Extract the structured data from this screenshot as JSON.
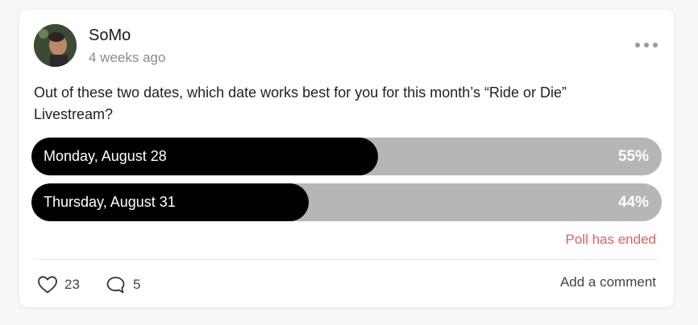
{
  "post": {
    "author": "SoMo",
    "time": "4 weeks ago",
    "question": "Out of these two dates, which date works best for you for this month’s “Ride or Die” Livestream?"
  },
  "poll": {
    "options": [
      {
        "label": "Monday, August 28",
        "percent_text": "55%",
        "fill_fraction": 0.55
      },
      {
        "label": "Thursday, August 31",
        "percent_text": "44%",
        "fill_fraction": 0.44
      }
    ],
    "status": "Poll has ended"
  },
  "footer": {
    "likes": "23",
    "comments": "5",
    "add_comment_label": "Add a comment"
  },
  "icons": {
    "more": "more-horizontal-icon",
    "like": "heart-outline-icon",
    "comment": "speech-bubble-icon"
  },
  "colors": {
    "poll_fill": "#000000",
    "poll_track": "#b6b6b6",
    "status_ended": "#e06060"
  }
}
